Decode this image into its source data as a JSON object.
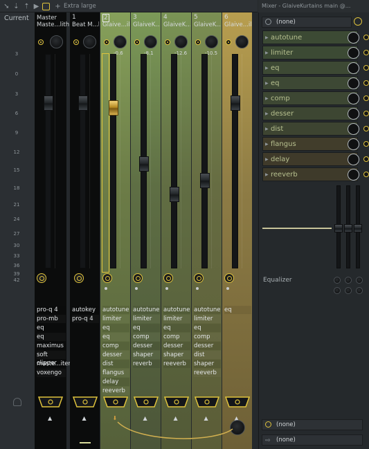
{
  "toolbar": {
    "size_label": "Extra large",
    "icons": [
      "arrow-right-icon",
      "arrow-down-icon",
      "arrow-up-icon",
      "play-step-icon",
      "layout-icon",
      "plus-icon"
    ]
  },
  "window": {
    "title": "Mixer - GlaiveKurtains main @..."
  },
  "left_label": {
    "current": "Current",
    "scale": [
      "3",
      "0",
      "3",
      "6",
      "9",
      "12",
      "15",
      "18",
      "21",
      "24",
      "27",
      "30",
      "33",
      "36",
      "39",
      "42"
    ]
  },
  "strips": [
    {
      "num": "",
      "name": "Master",
      "sub": "Maste...lith",
      "pan": "",
      "fx": [
        "pro-q 4",
        "pro-mb",
        "eq",
        "eq",
        "maximus",
        "soft clipper",
        "maste...iter",
        "voxengo"
      ]
    },
    {
      "num": "1",
      "name": "Beat M...lith",
      "sub": "",
      "pan": "",
      "fx": [
        "autokey",
        "pro-q 4"
      ]
    },
    {
      "num": "2",
      "name": "Glaive...ilith",
      "sub": "",
      "pan": "-0.6",
      "fx": [
        "autotune",
        "limiter",
        "eq",
        "eq",
        "comp",
        "desser",
        "dist",
        "flangus",
        "delay",
        "reeverb"
      ]
    },
    {
      "num": "3",
      "name": "GlaiveK...lith",
      "sub": "",
      "pan": "-8.1",
      "fx": [
        "autotune",
        "limiter",
        "eq",
        "comp",
        "desser",
        "shaper",
        "reverb"
      ]
    },
    {
      "num": "4",
      "name": "GlaiveK...lith",
      "sub": "",
      "pan": "-12.6",
      "fx": [
        "autotune",
        "limiter",
        "eq",
        "comp",
        "desser",
        "shaper",
        "reeverb"
      ]
    },
    {
      "num": "5",
      "name": "GlaiveK...lith",
      "sub": "",
      "pan": "-10.5",
      "fx": [
        "autotune",
        "limiter",
        "eq",
        "comp",
        "desser",
        "dist",
        "shaper",
        "reeverb"
      ]
    },
    {
      "num": "6",
      "name": "Glaive...ilith",
      "sub": "",
      "pan": "",
      "fx": [
        "eq"
      ]
    }
  ],
  "right_panel": {
    "input_select": "(none)",
    "slots": [
      "autotune",
      "limiter",
      "eq",
      "eq",
      "comp",
      "desser",
      "dist",
      "flangus",
      "delay",
      "reeverb"
    ],
    "equalizer_label": "Equalizer",
    "output_top": "(none)",
    "output_bottom": "(none)"
  },
  "colors": {
    "accent": "#e0c33c",
    "selected_strip": "#7e8f55"
  }
}
